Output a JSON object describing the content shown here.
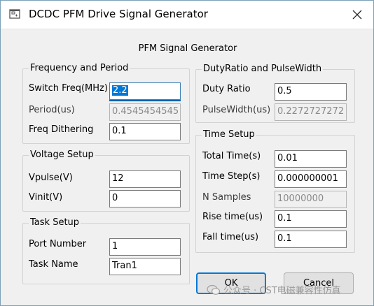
{
  "window": {
    "title": "DCDC PFM Drive Signal Generator"
  },
  "heading": "PFM Signal Generator",
  "freq_group": {
    "legend": "Frequency and Period",
    "switch_freq_label": "Switch Freq(MHz)",
    "switch_freq_value": "2.2",
    "period_label": "Period(us)",
    "period_value": "0.4545454545",
    "freq_dithering_label": "Freq Dithering",
    "freq_dithering_value": "0.1"
  },
  "voltage_group": {
    "legend": "Voltage Setup",
    "vpulse_label": "Vpulse(V)",
    "vpulse_value": "12",
    "vinit_label": "Vinit(V)",
    "vinit_value": "0"
  },
  "task_group": {
    "legend": "Task Setup",
    "port_number_label": "Port Number",
    "port_number_value": "1",
    "task_name_label": "Task Name",
    "task_name_value": "Tran1"
  },
  "duty_group": {
    "legend": "DutyRatio and PulseWidth",
    "duty_ratio_label": "Duty Ratio",
    "duty_ratio_value": "0.5",
    "pulse_width_label": "PulseWidth(us)",
    "pulse_width_value": "0.2272727272"
  },
  "time_group": {
    "legend": "Time Setup",
    "total_time_label": "Total Time(s)",
    "total_time_value": "0.01",
    "time_step_label": "Time Step(s)",
    "time_step_value": "0.000000001",
    "n_samples_label": "N Samples",
    "n_samples_value": "10000000",
    "rise_time_label": "Rise time(us)",
    "rise_time_value": "0.1",
    "fall_time_label": "Fall time(us)",
    "fall_time_value": "0.1"
  },
  "buttons": {
    "ok": "OK",
    "cancel": "Cancel"
  },
  "watermark": {
    "text": "公众号 · CST电磁兼容性仿真"
  },
  "colors": {
    "accent": "#0078d7",
    "focus_underline": "#0063b1"
  }
}
